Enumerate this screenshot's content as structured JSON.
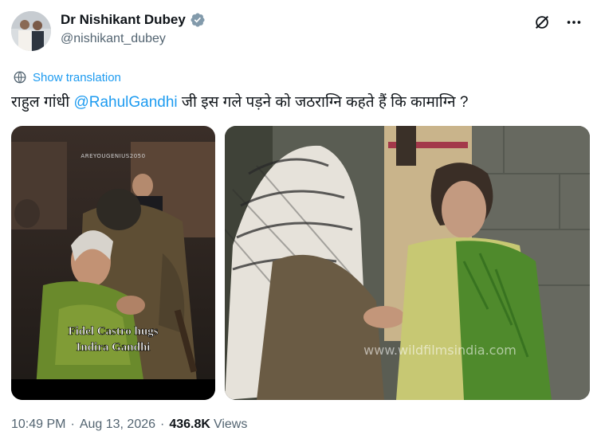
{
  "author": {
    "display_name": "Dr Nishikant Dubey",
    "handle": "@nishikant_dubey"
  },
  "translate_label": "Show translation",
  "tweet": {
    "prefix": "राहुल गांधी ",
    "mention": "@RahulGandhi",
    "suffix": " जी इस गले पड़ने को जठराग्नि कहते हैं कि कामाग्नि ?"
  },
  "media": [
    {
      "watermark": "AREYOUGENIUS2050",
      "caption_line1": "Fidel Castro hugs",
      "caption_line2": "Indira Gandhi"
    },
    {
      "watermark": "www.wildfilmsindia.com"
    }
  ],
  "meta": {
    "time": "10:49 PM",
    "date": "Aug 13, 2026",
    "views_count": "436.8K",
    "views_label": "Views"
  },
  "colors": {
    "accent": "#1d9bf0",
    "secondary_text": "#536471",
    "primary_text": "#0f1419",
    "verified_badge": "#829aab"
  },
  "icons": [
    "grok-icon",
    "more-icon",
    "translate-globe-icon",
    "verified-badge-icon"
  ]
}
